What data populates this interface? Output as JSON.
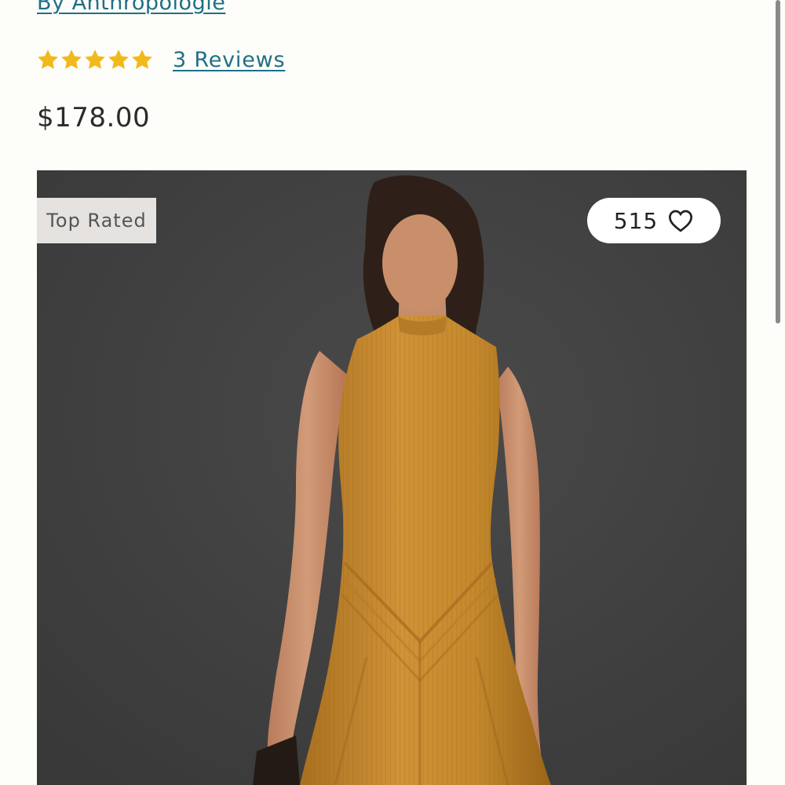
{
  "product": {
    "brand_link": "By Anthropologie",
    "rating": 5,
    "rating_max": 5,
    "reviews_label": "3 Reviews",
    "price": "$178.00"
  },
  "image": {
    "badge": "Top Rated",
    "favorite_count": "515",
    "favorite_icon": "heart-outline-icon"
  },
  "colors": {
    "link": "#1f6f86",
    "star": "#f2b91a",
    "badge_bg": "#e6e2df",
    "image_bg": "#414141",
    "dress": "#c58a2b"
  }
}
